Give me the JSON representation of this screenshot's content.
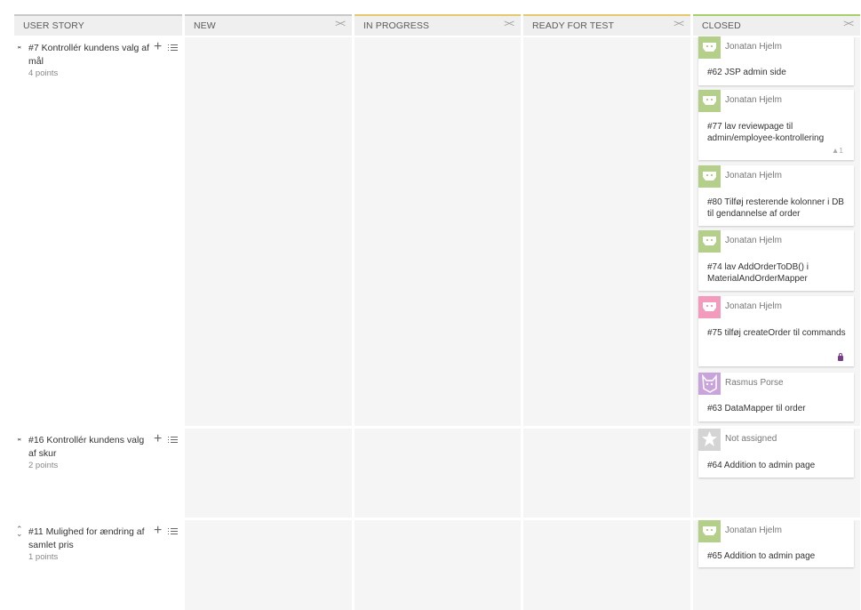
{
  "columns": {
    "story": "USER STORY",
    "new": "NEW",
    "in_progress": "IN PROGRESS",
    "ready": "READY FOR TEST",
    "closed": "CLOSED",
    "fold_glyph": "><"
  },
  "stories": [
    {
      "title": "#7 Kontrollér kundens valg af mål",
      "points": "4 points"
    },
    {
      "title": "#16 Kontrollér kundens valg af skur",
      "points": "2 points"
    },
    {
      "title": "#11 Mulighed for ændring af samlet pris",
      "points": "1 points"
    }
  ],
  "cards": [
    {
      "user": "Jonatan Hjelm",
      "text": "#62 JSP admin side",
      "avatar": "green"
    },
    {
      "user": "Jonatan Hjelm",
      "text": "#77 lav reviewpage til admin/employee-kontrollering",
      "votes": "▲1",
      "avatar": "green"
    },
    {
      "user": "Jonatan Hjelm",
      "text": "#80 Tilføj resterende kolonner i DB til gendannelse af order",
      "avatar": "green"
    },
    {
      "user": "Jonatan Hjelm",
      "text": "#74 lav AddOrderToDB() i MaterialAndOrderMapper",
      "avatar": "green"
    },
    {
      "user": "Jonatan Hjelm",
      "text": "#75 tilføj createOrder til commands",
      "avatar": "pink",
      "locked": true
    },
    {
      "user": "Rasmus Porse",
      "text": "#63 DataMapper til order",
      "avatar": "purple"
    },
    {
      "user": "Not assigned",
      "text": "#64 Addition to admin page",
      "avatar": "gray"
    },
    {
      "user": "Jonatan Hjelm",
      "text": "#65 Addition to admin page",
      "avatar": "green"
    }
  ],
  "colors": {
    "avatar_green": "#b4cf8a",
    "avatar_pink": "#f29bbd",
    "avatar_purple": "#c9a3db",
    "avatar_gray": "#d4d4d4",
    "in_progress_accent": "#e7c86c",
    "closed_accent": "#a7cf6a"
  }
}
